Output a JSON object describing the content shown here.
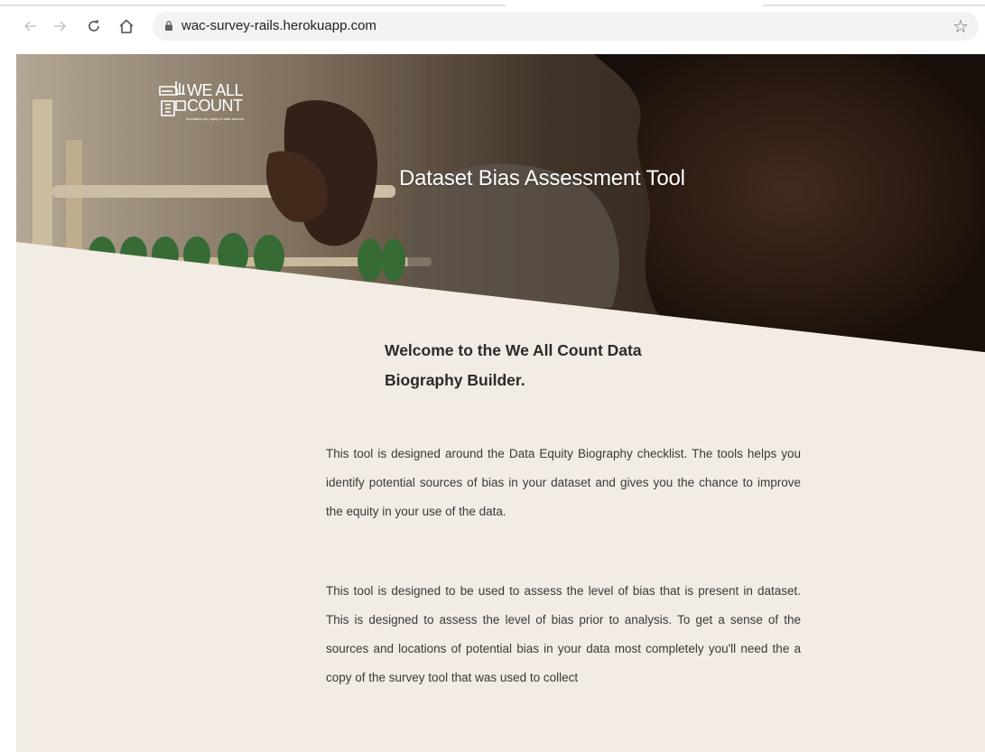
{
  "browser": {
    "url": "wac-survey-rails.herokuapp.com",
    "back_icon": "←",
    "forward_icon": "→",
    "star_icon": "☆"
  },
  "hero": {
    "logo_line1": "WE ALL",
    "logo_line2": "COUNT",
    "logo_tagline": "foundation for equity in data science",
    "title": "Dataset Bias Assessment Tool"
  },
  "content": {
    "welcome_heading": "Welcome to the We All Count Data Biography Builder.",
    "paragraph1": "This tool is designed around the Data Equity Biography checklist. The tools helps you identify potential sources of bias in your dataset and gives you the chance to improve the equity in your use of the data.",
    "paragraph2": "This tool is designed to be used to assess the level of bias that is present in dataset. This is designed to assess the level of bias prior to analysis. To get a sense of the sources and locations of potential bias in your data most completely you'll need the a copy of the survey tool that was used to collect"
  },
  "colors": {
    "page_background": "#f2ece4",
    "heading_text": "#2b2b2b",
    "body_text": "#3a3a3a"
  }
}
